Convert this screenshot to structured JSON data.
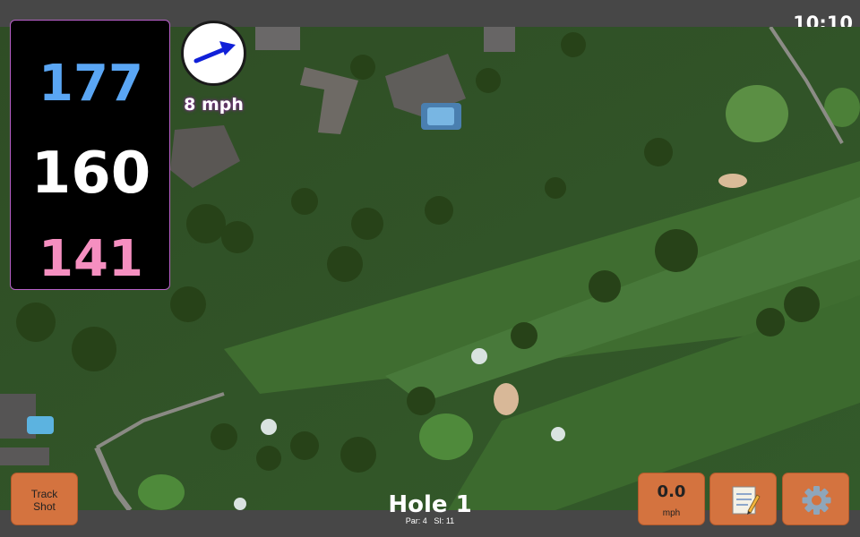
{
  "status_bar": {
    "time": "10:10"
  },
  "distances": {
    "back": "177",
    "middle": "160",
    "front": "141"
  },
  "wind": {
    "speed": "8 mph",
    "direction_icon": "arrow-right-up-icon"
  },
  "hole": {
    "title": "Hole 1",
    "par": "Par: 4",
    "stroke_index": "SI: 11"
  },
  "buttons": {
    "track_shot": {
      "line1": "Track",
      "line2": "Shot"
    },
    "speed": {
      "value": "0.0",
      "unit": "mph"
    },
    "notes": {
      "icon": "notepad-icon"
    },
    "settings": {
      "icon": "gear-icon"
    }
  },
  "colors": {
    "back_distance": "#5aa6f4",
    "middle_distance": "#ffffff",
    "front_distance": "#f58fc0",
    "button": "#d4733f",
    "panel_border": "#b760c8"
  }
}
